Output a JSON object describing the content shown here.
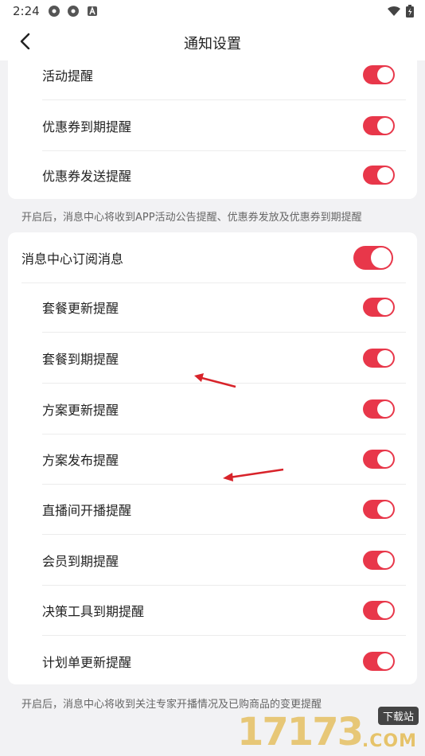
{
  "status_bar": {
    "time": "2:24"
  },
  "header": {
    "title": "通知设置"
  },
  "card1": {
    "items": [
      {
        "label": "活动提醒",
        "on": true
      },
      {
        "label": "优惠券到期提醒",
        "on": true
      },
      {
        "label": "优惠券发送提醒",
        "on": true
      }
    ]
  },
  "note1": "开启后，消息中心将收到APP活动公告提醒、优惠券发放及优惠券到期提醒",
  "card2": {
    "main": {
      "label": "消息中心订阅消息",
      "on": true
    },
    "items": [
      {
        "label": "套餐更新提醒",
        "on": true
      },
      {
        "label": "套餐到期提醒",
        "on": true
      },
      {
        "label": "方案更新提醒",
        "on": true
      },
      {
        "label": "方案发布提醒",
        "on": true
      },
      {
        "label": "直播间开播提醒",
        "on": true
      },
      {
        "label": "会员到期提醒",
        "on": true
      },
      {
        "label": "决策工具到期提醒",
        "on": true
      },
      {
        "label": "计划单更新提醒",
        "on": true
      }
    ]
  },
  "note2": "开启后，消息中心将收到关注专家开播情况及已购商品的变更提醒",
  "watermark": {
    "number": "17173",
    "tag": "下载站",
    "domain": ".COM"
  },
  "colors": {
    "accent": "#e8374a",
    "background": "#f2f2f4"
  }
}
